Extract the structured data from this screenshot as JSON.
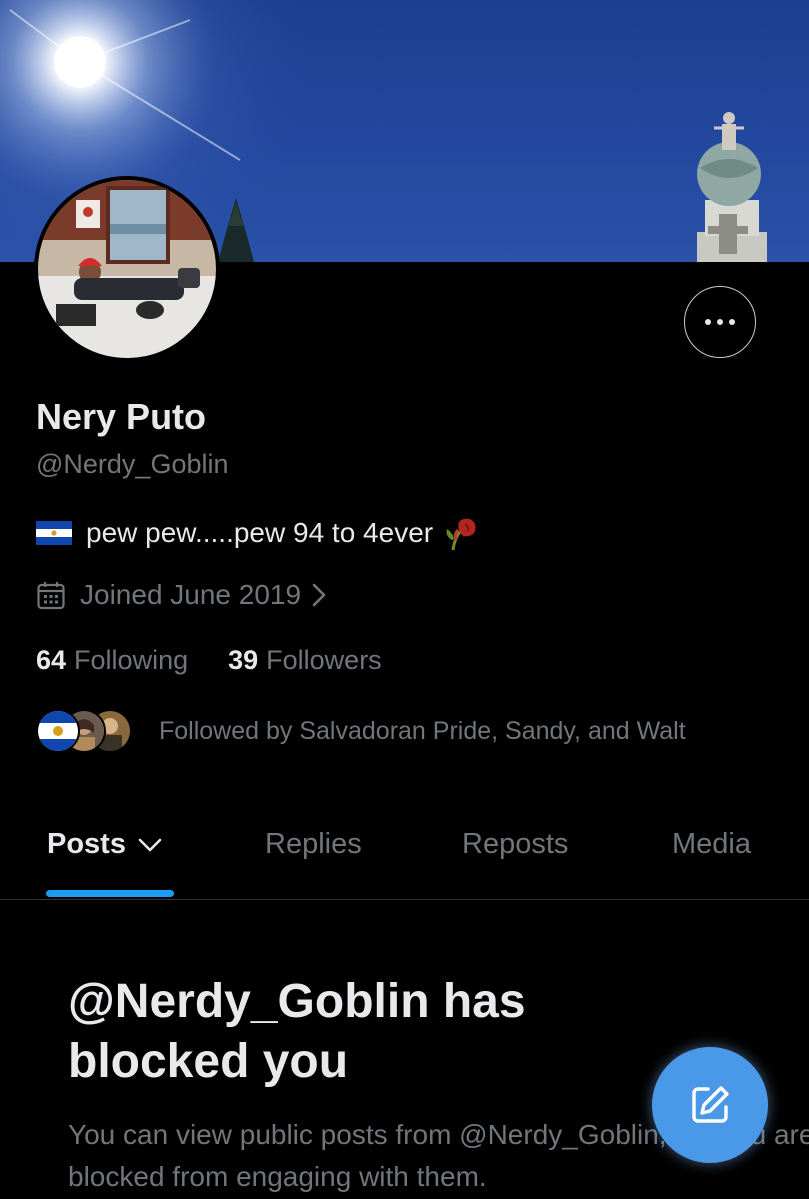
{
  "profile": {
    "name": "Nery Puto",
    "handle": "@Nerdy_Goblin",
    "bio_text": "pew pew.....pew 94 to 4ever",
    "bio_flag_icon": "el-salvador-flag-emoji",
    "bio_end_icon": "wilted-rose-emoji",
    "joined": "Joined June 2019",
    "following_count": "64",
    "following_label": "Following",
    "followers_count": "39",
    "followers_label": "Followers",
    "followed_by": "Followed by Salvadoran Pride, Sandy, and Walt"
  },
  "tabs": [
    {
      "label": "Posts",
      "active": true
    },
    {
      "label": "Replies",
      "active": false
    },
    {
      "label": "Reposts",
      "active": false
    },
    {
      "label": "Media",
      "active": false
    }
  ],
  "blocked": {
    "title": "@Nerdy_Goblin has blocked you",
    "message": "You can view public posts from @Nerdy_Goblin, but you are blocked from engaging with them."
  },
  "colors": {
    "background": "#000000",
    "text_primary": "#e7e9ea",
    "text_secondary": "#71767b",
    "accent": "#1d9bf0",
    "compose_button": "#4a99e9",
    "divider": "#2f3336"
  },
  "icons": {
    "more": "ellipsis-icon",
    "calendar": "calendar-icon",
    "joined_chevron": "chevron-right-icon",
    "tab_caret": "chevron-down-icon",
    "compose": "compose-icon"
  }
}
